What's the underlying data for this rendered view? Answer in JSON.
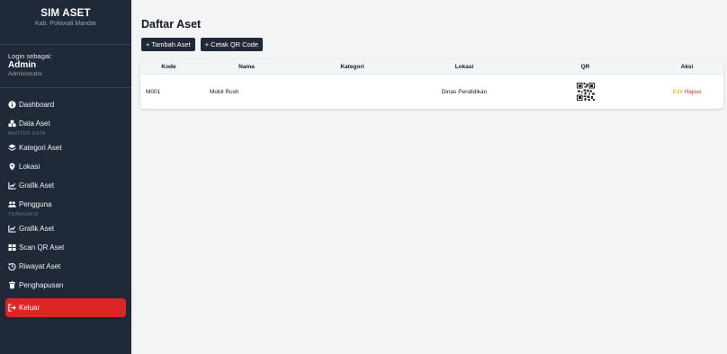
{
  "brand": {
    "title": "SIM ASET",
    "subtitle": "Kab. Polewali Mandar"
  },
  "login": {
    "label": "Login sebagai:",
    "name": "Admin",
    "role": "Administrator"
  },
  "menu": {
    "dashboard": "Dashboard",
    "data_aset": "Data Aset",
    "section_master": "MASTER DATA",
    "kategori": "Kategori Aset",
    "lokasi": "Lokasi",
    "grafik1": "Grafik Aset",
    "pengguna": "Pengguna",
    "section_transaksi": "TRANSAKSI",
    "grafik2": "Grafik Aset",
    "scan": "Scan QR Aset",
    "riwayat": "Riwayat Aset",
    "penghapusan": "Penghapusan",
    "keluar": "Keluar"
  },
  "main": {
    "title": "Daftar Aset",
    "btn_tambah": "+ Tambah Aset",
    "btn_cetak": "+ Cetak QR Code"
  },
  "table": {
    "headers": {
      "kode": "Kode",
      "nama": "Nama",
      "kategori": "Kategori",
      "lokasi": "Lokasi",
      "qr": "QR",
      "aksi": "Aksi"
    },
    "rows": [
      {
        "kode": "M001",
        "nama": "Mobil Rush",
        "kategori": "",
        "lokasi": "Dinas Pendidikan",
        "edit": "Edit",
        "hapus": "Hapus"
      }
    ]
  },
  "colors": {
    "sidebar": "#1f2937",
    "logout": "#dc2626",
    "edit": "#f59e0b",
    "hapus": "#dc2626"
  }
}
